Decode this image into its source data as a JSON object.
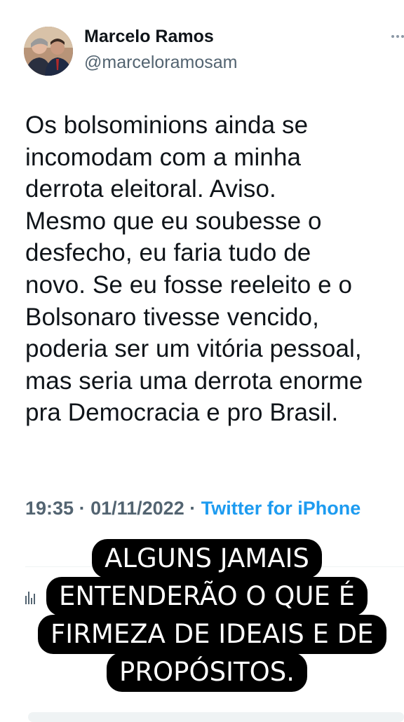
{
  "author": {
    "display_name": "Marcelo Ramos",
    "handle": "@marceloramosam"
  },
  "tweet": {
    "text": "Os bolsominions ainda se\nincomodam com a minha\nderrota eleitoral. Aviso.\nMesmo que eu soubesse o\ndesfecho, eu faria tudo de\nnovo. Se eu fosse reeleito e o\nBolsonaro tivesse vencido,\npoderia ser um vitória pessoal,\nmas seria uma derrota enorme\npra Democracia e pro Brasil.",
    "time": "19:35",
    "separator": " · ",
    "date": "01/11/2022",
    "source": "Twitter for iPhone"
  },
  "overlay": {
    "lines": [
      "ALGUNS JAMAIS",
      "ENTENDERÃO O QUE É",
      "FIRMEZA DE IDEAIS E DE",
      "PROPÓSITOS."
    ]
  },
  "icons": {
    "more": "more-icon",
    "analytics": "analytics-icon"
  },
  "colors": {
    "text": "#0f1419",
    "muted": "#536471",
    "link": "#1d9bf0",
    "overlay_bg": "#000000",
    "overlay_text": "#ffffff"
  }
}
